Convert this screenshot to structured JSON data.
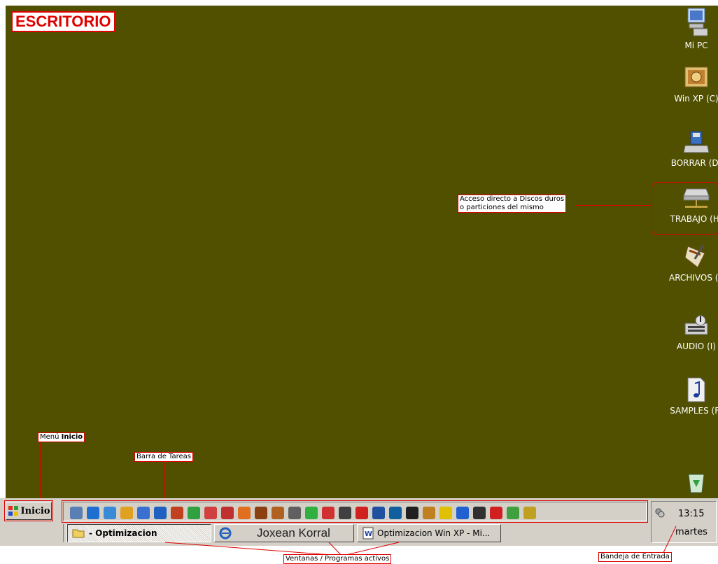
{
  "desktop": {
    "title": "ESCRITORIO",
    "icons": [
      {
        "label": "Mi PC",
        "icon": "my-computer-icon"
      },
      {
        "label": "Win XP (C)",
        "icon": "hard-drive-icon"
      },
      {
        "label": "BORRAR (D)",
        "icon": "drive-icon"
      },
      {
        "label": "TRABAJO (H)",
        "icon": "network-drive-icon"
      },
      {
        "label": "ARCHIVOS (E",
        "icon": "archive-icon"
      },
      {
        "label": "AUDIO (I)",
        "icon": "audio-drive-icon"
      },
      {
        "label": "SAMPLES (F)",
        "icon": "music-note-icon"
      },
      {
        "label": "",
        "icon": "recycle-bin-icon"
      }
    ]
  },
  "annotations": {
    "discos_line1": "Acceso directo a Discos duros",
    "discos_line2": "o particiones del mismo",
    "menu_prefix": "Menú ",
    "menu_bold": "Inicio",
    "barra": "Barra de Tareas",
    "ventanas": "Ventanas / Programas activos",
    "bandeja": "Bandeja de Entrada"
  },
  "taskbar": {
    "start_label": "Inicio",
    "quick_launch_count_colors": [
      "#5a7fb5",
      "#1e6fd0",
      "#3a8ad8",
      "#e0a020",
      "#3a70d0",
      "#2060c0",
      "#c04020",
      "#30a040",
      "#d04040",
      "#c03030",
      "#e07020",
      "#8a4010",
      "#b06020",
      "#606060",
      "#30b040",
      "#d03030",
      "#404040",
      "#d02020",
      "#2050a0",
      "#1060a0",
      "#202020",
      "#c08020",
      "#e0c000",
      "#2060d0",
      "#303030",
      "#d02020",
      "#40a040",
      "#c0a020"
    ],
    "tasks": [
      {
        "label": "- Optimizacion",
        "icon": "folder-icon"
      },
      {
        "label": "Joxean Korral",
        "icon": "internet-explorer-icon"
      },
      {
        "label": "Optimizacion Win XP - Mi...",
        "icon": "word-document-icon"
      }
    ],
    "tray": {
      "time": "13:15",
      "day": "martes"
    }
  }
}
